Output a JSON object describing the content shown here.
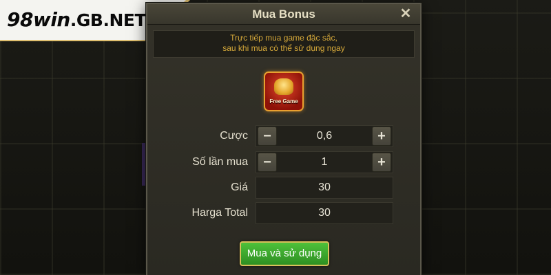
{
  "brand": {
    "name": "98win",
    "suffix": ".GB.NET"
  },
  "dialog": {
    "title": "Mua Bonus",
    "notice_line1": "Trực tiếp mua game đặc sắc,",
    "notice_line2": "sau khi mua có thể sử dụng ngay",
    "feature_label": "Free Game",
    "rows": {
      "bet": {
        "label": "Cược",
        "value": "0,6"
      },
      "count": {
        "label": "Số lần mua",
        "value": "1"
      },
      "price": {
        "label": "Giá",
        "value": "30"
      },
      "total": {
        "label": "Harga Total",
        "value": "30"
      }
    },
    "buy_label": "Mua và sử dụng"
  },
  "icons": {
    "close": "close-icon",
    "minus": "minus-icon",
    "plus": "plus-icon",
    "feature": "free-game-icon"
  },
  "colors": {
    "accent_gold": "#d6a93a",
    "buy_green": "#3aa82c"
  }
}
